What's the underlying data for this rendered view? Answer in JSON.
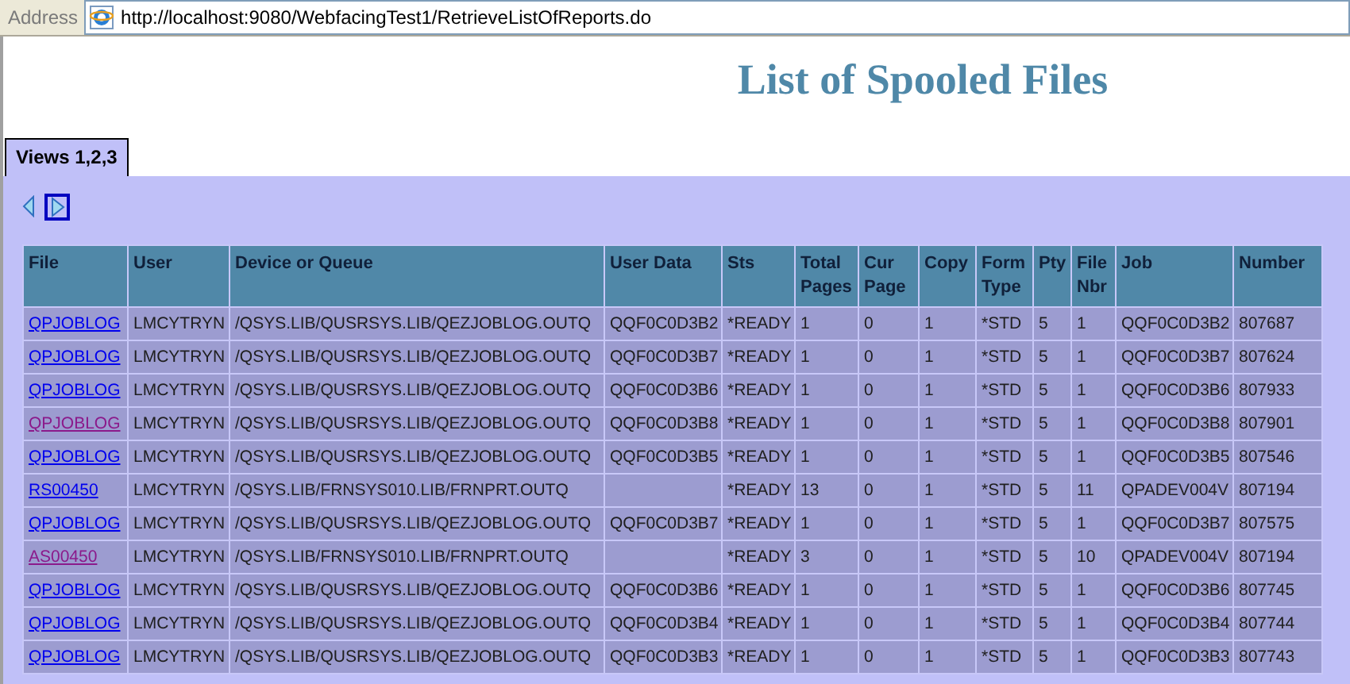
{
  "address_bar": {
    "label": "Address",
    "url": "http://localhost:9080/WebfacingTest1/RetrieveListOfReports.do"
  },
  "title": "List of Spooled Files",
  "tabs": [
    {
      "label": "Views 1,2,3",
      "selected": true
    }
  ],
  "table": {
    "columns": [
      "File",
      "User",
      "Device or Queue",
      "User Data",
      "Sts",
      "Total Pages",
      "Cur Page",
      "Copy",
      "Form Type",
      "Pty",
      "File Nbr",
      "Job",
      "Number"
    ],
    "rows": [
      {
        "visited": false,
        "cells": [
          "QPJOBLOG",
          "LMCYTRYN",
          "/QSYS.LIB/QUSRSYS.LIB/QEZJOBLOG.OUTQ",
          "QQF0C0D3B2",
          "*READY",
          "1",
          "0",
          "1",
          "*STD",
          "5",
          "1",
          "QQF0C0D3B2",
          "807687"
        ]
      },
      {
        "visited": false,
        "cells": [
          "QPJOBLOG",
          "LMCYTRYN",
          "/QSYS.LIB/QUSRSYS.LIB/QEZJOBLOG.OUTQ",
          "QQF0C0D3B7",
          "*READY",
          "1",
          "0",
          "1",
          "*STD",
          "5",
          "1",
          "QQF0C0D3B7",
          "807624"
        ]
      },
      {
        "visited": false,
        "cells": [
          "QPJOBLOG",
          "LMCYTRYN",
          "/QSYS.LIB/QUSRSYS.LIB/QEZJOBLOG.OUTQ",
          "QQF0C0D3B6",
          "*READY",
          "1",
          "0",
          "1",
          "*STD",
          "5",
          "1",
          "QQF0C0D3B6",
          "807933"
        ]
      },
      {
        "visited": true,
        "cells": [
          "QPJOBLOG",
          "LMCYTRYN",
          "/QSYS.LIB/QUSRSYS.LIB/QEZJOBLOG.OUTQ",
          "QQF0C0D3B8",
          "*READY",
          "1",
          "0",
          "1",
          "*STD",
          "5",
          "1",
          "QQF0C0D3B8",
          "807901"
        ]
      },
      {
        "visited": false,
        "cells": [
          "QPJOBLOG",
          "LMCYTRYN",
          "/QSYS.LIB/QUSRSYS.LIB/QEZJOBLOG.OUTQ",
          "QQF0C0D3B5",
          "*READY",
          "1",
          "0",
          "1",
          "*STD",
          "5",
          "1",
          "QQF0C0D3B5",
          "807546"
        ]
      },
      {
        "visited": false,
        "cells": [
          "RS00450",
          "LMCYTRYN",
          "/QSYS.LIB/FRNSYS010.LIB/FRNPRT.OUTQ",
          "",
          "*READY",
          "13",
          "0",
          "1",
          "*STD",
          "5",
          "11",
          "QPADEV004V",
          "807194"
        ]
      },
      {
        "visited": false,
        "cells": [
          "QPJOBLOG",
          "LMCYTRYN",
          "/QSYS.LIB/QUSRSYS.LIB/QEZJOBLOG.OUTQ",
          "QQF0C0D3B7",
          "*READY",
          "1",
          "0",
          "1",
          "*STD",
          "5",
          "1",
          "QQF0C0D3B7",
          "807575"
        ]
      },
      {
        "visited": true,
        "cells": [
          "AS00450",
          "LMCYTRYN",
          "/QSYS.LIB/FRNSYS010.LIB/FRNPRT.OUTQ",
          "",
          "*READY",
          "3",
          "0",
          "1",
          "*STD",
          "5",
          "10",
          "QPADEV004V",
          "807194"
        ]
      },
      {
        "visited": false,
        "cells": [
          "QPJOBLOG",
          "LMCYTRYN",
          "/QSYS.LIB/QUSRSYS.LIB/QEZJOBLOG.OUTQ",
          "QQF0C0D3B6",
          "*READY",
          "1",
          "0",
          "1",
          "*STD",
          "5",
          "1",
          "QQF0C0D3B6",
          "807745"
        ]
      },
      {
        "visited": false,
        "cells": [
          "QPJOBLOG",
          "LMCYTRYN",
          "/QSYS.LIB/QUSRSYS.LIB/QEZJOBLOG.OUTQ",
          "QQF0C0D3B4",
          "*READY",
          "1",
          "0",
          "1",
          "*STD",
          "5",
          "1",
          "QQF0C0D3B4",
          "807744"
        ]
      },
      {
        "visited": false,
        "cells": [
          "QPJOBLOG",
          "LMCYTRYN",
          "/QSYS.LIB/QUSRSYS.LIB/QEZJOBLOG.OUTQ",
          "QQF0C0D3B3",
          "*READY",
          "1",
          "0",
          "1",
          "*STD",
          "5",
          "1",
          "QQF0C0D3B3",
          "807743"
        ]
      }
    ]
  }
}
